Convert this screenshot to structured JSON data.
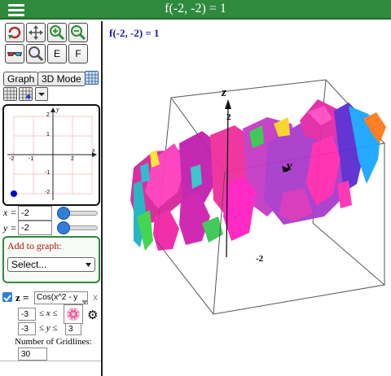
{
  "header": {
    "title": "f(-2, -2) = 1"
  },
  "toolbar": {
    "e_label": "E",
    "f_label": "F"
  },
  "view": {
    "graph_label": "Graph",
    "mode_label": "3D Mode"
  },
  "graph2d": {
    "tick_labels": {
      "x_neg": "-2",
      "x_neg2": "-1",
      "x_pos": "2",
      "x_axis": "x",
      "y_axis": "y",
      "y_pos": "2",
      "y_pos1": "1",
      "y_neg": "-1",
      "y_neg2": "-2"
    },
    "point_color": "#0000cc"
  },
  "controls": {
    "x_label": "x =",
    "x_value": "-2",
    "y_label": "y =",
    "y_value": "-2"
  },
  "add_to_graph": {
    "label": "Add to graph:",
    "select_value": "Select..."
  },
  "function": {
    "checked": true,
    "lhs": "z =",
    "expression": "Cos(x^2 - y",
    "close": "x",
    "x_min": "-3",
    "x_ineq": "≤ x ≤",
    "y_min": "-3",
    "y_ineq": "≤ y ≤",
    "y_max": "3",
    "gridlines_label": "Number of Gridlines:",
    "gridlines_value": "30"
  },
  "plot3d": {
    "value_label": "f(-2, -2) = 1",
    "axis_z": "z",
    "axis_y": "y",
    "tick_2": "2",
    "tick_neg2": "-2"
  },
  "colors": {
    "header_green": "#2f8a3e",
    "label_blue": "#1818a8",
    "add_red": "#b01010"
  }
}
